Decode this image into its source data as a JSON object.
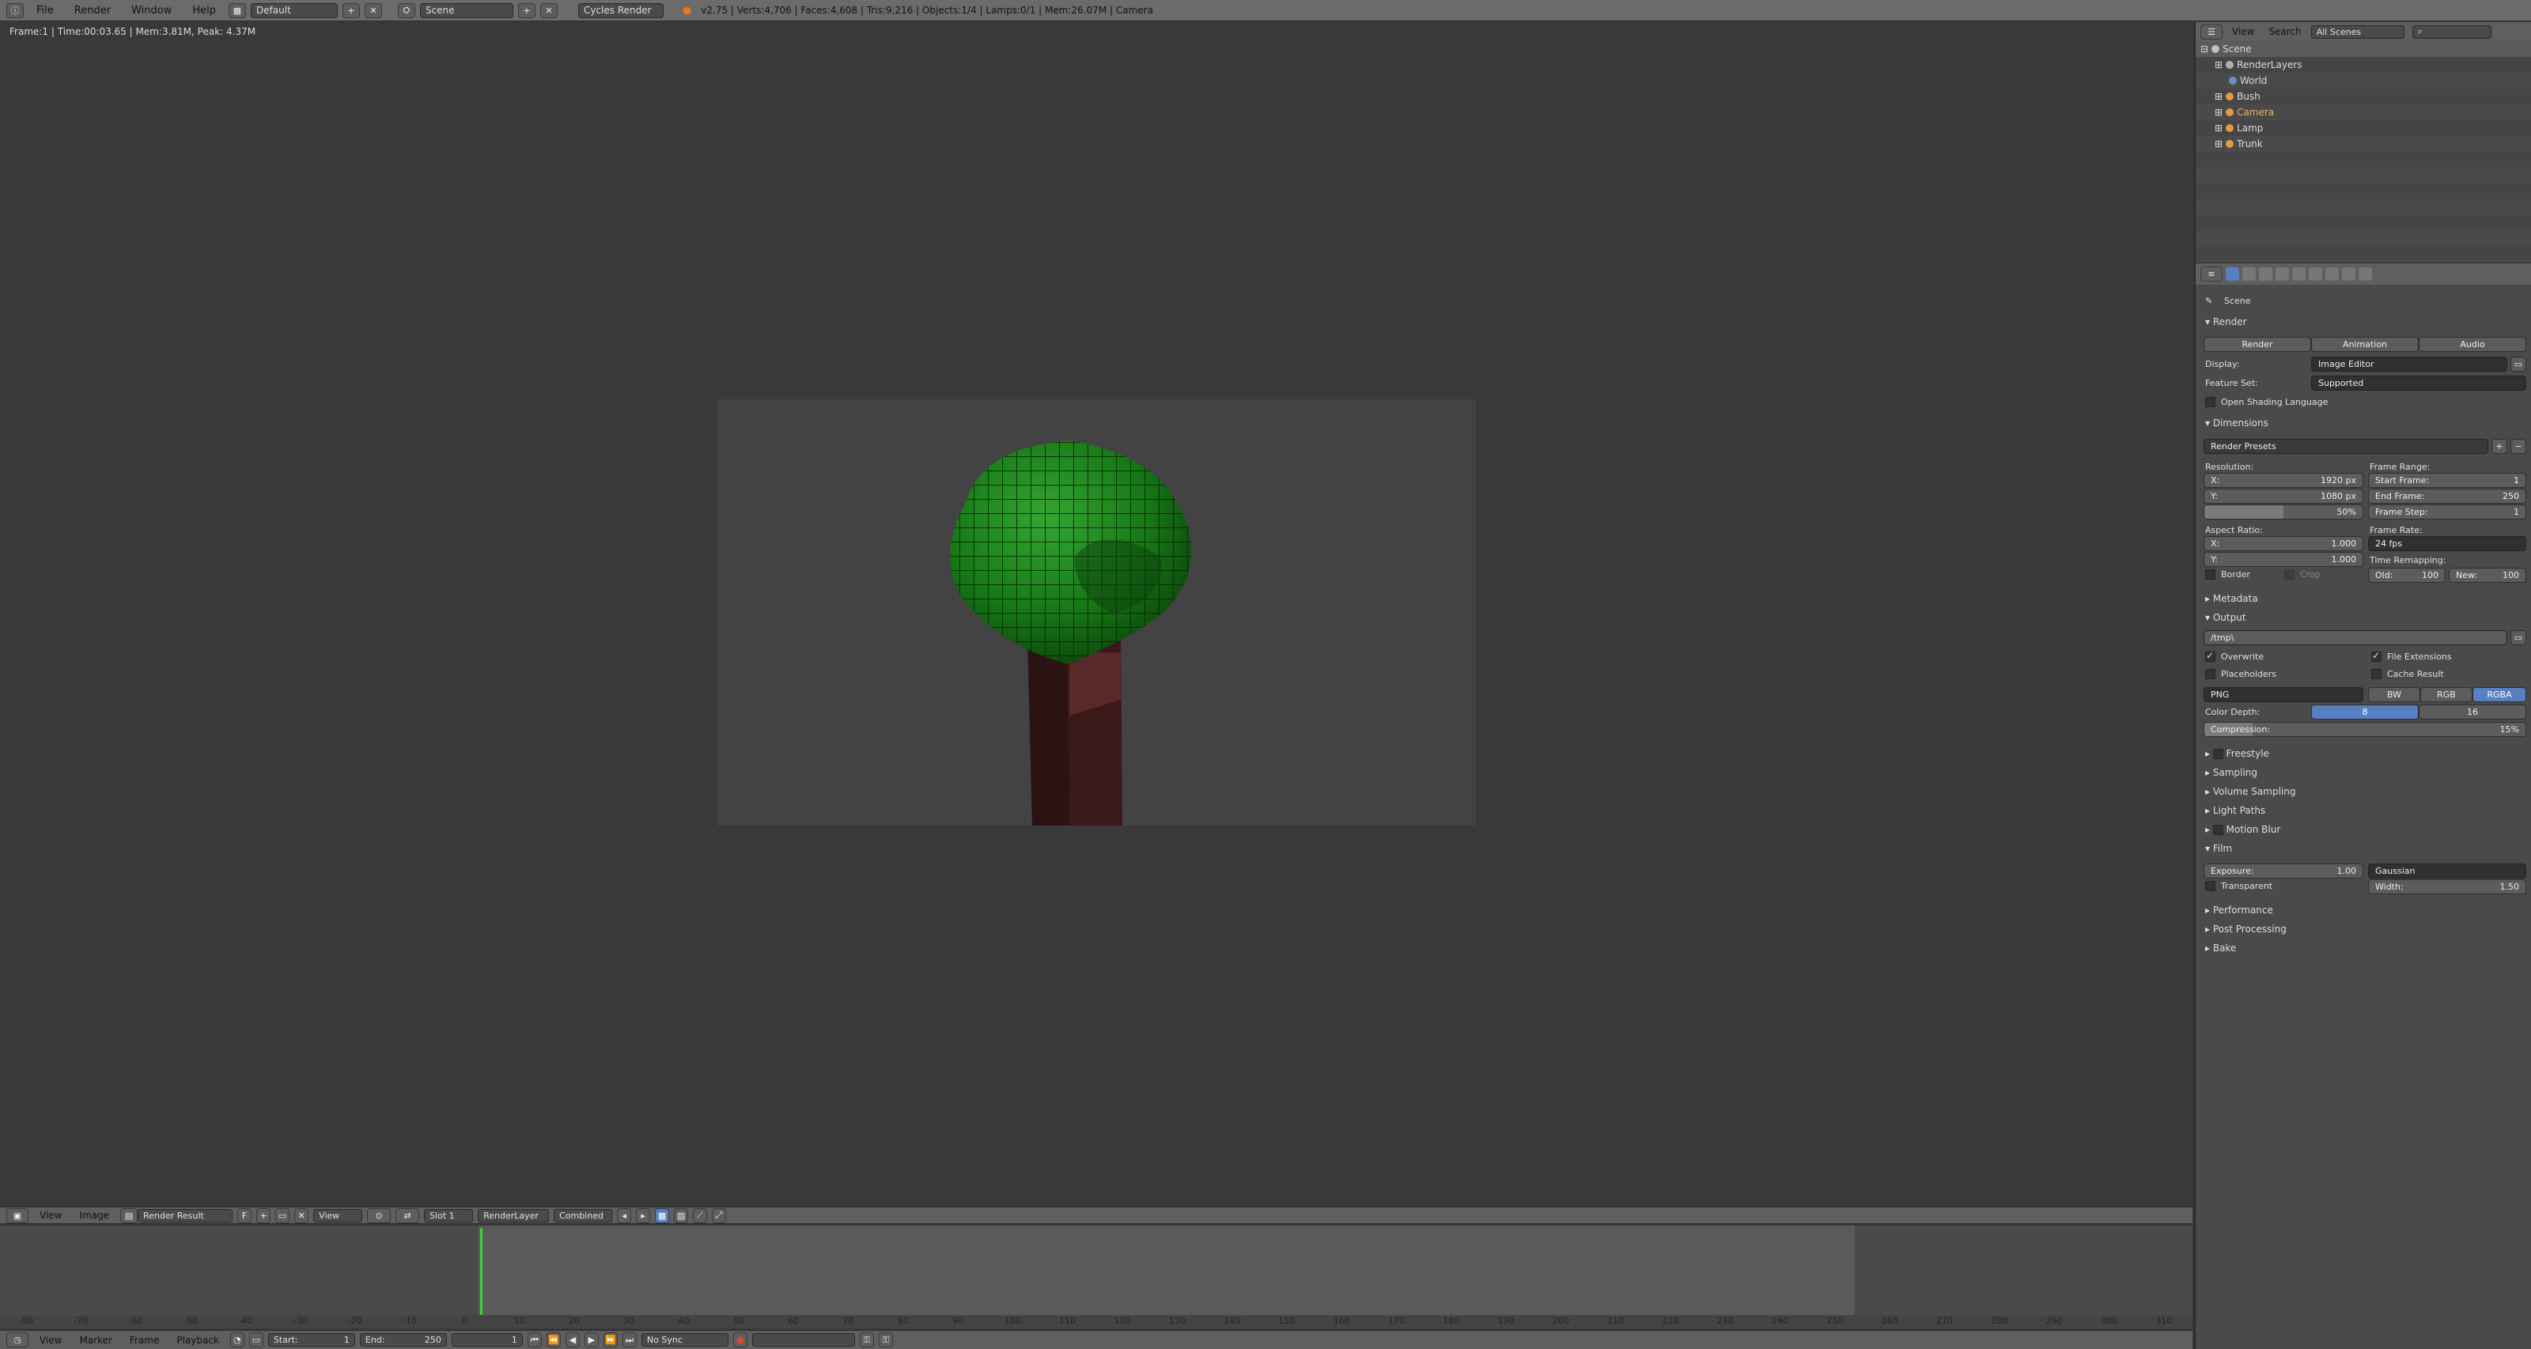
{
  "topbar": {
    "menus": [
      "File",
      "Render",
      "Window",
      "Help"
    ],
    "layout": "Default",
    "scene": "Scene",
    "engine": "Cycles Render",
    "stats": "v2.75 | Verts:4,706 | Faces:4,608 | Tris:9,216 | Objects:1/4 | Lamps:0/1 | Mem:26.07M | Camera"
  },
  "viewport": {
    "render_info": "Frame:1 | Time:00:03.65 | Mem:3.81M, Peak: 4.37M"
  },
  "image_editor": {
    "menus": [
      "View",
      "Image"
    ],
    "image_name": "Render Result",
    "fake_user": "F",
    "view_label": "View",
    "slot": "Slot 1",
    "render_layer": "RenderLayer",
    "pass": "Combined"
  },
  "timeline": {
    "current_frame": 1,
    "ticks": [
      "-80",
      "-70",
      "-60",
      "-50",
      "-40",
      "-30",
      "-20",
      "-10",
      "0",
      "10",
      "20",
      "30",
      "40",
      "50",
      "60",
      "70",
      "80",
      "90",
      "100",
      "110",
      "120",
      "130",
      "140",
      "150",
      "160",
      "170",
      "180",
      "190",
      "200",
      "210",
      "220",
      "230",
      "240",
      "250",
      "260",
      "270",
      "280",
      "290",
      "300",
      "310"
    ],
    "menus": [
      "View",
      "Marker",
      "Frame",
      "Playback"
    ],
    "start_label": "Start:",
    "start_value": "1",
    "end_label": "End:",
    "end_value": "250",
    "frame_value": "1",
    "sync": "No Sync"
  },
  "outliner": {
    "menus": [
      "View",
      "Search"
    ],
    "filter": "All Scenes",
    "items": [
      {
        "label": "Scene",
        "icon": "scene-icon",
        "color": "#c0c0c0"
      },
      {
        "label": "RenderLayers",
        "icon": "renderlayers-icon",
        "color": "#b0b0b0"
      },
      {
        "label": "World",
        "icon": "world-icon",
        "color": "#6a8fc0"
      },
      {
        "label": "Bush",
        "icon": "mesh-object-icon",
        "color": "#e39a3a"
      },
      {
        "label": "Camera",
        "icon": "camera-object-icon",
        "color": "#e39a3a"
      },
      {
        "label": "Lamp",
        "icon": "lamp-object-icon",
        "color": "#e39a3a"
      },
      {
        "label": "Trunk",
        "icon": "mesh-object-icon",
        "color": "#e39a3a"
      }
    ]
  },
  "properties": {
    "context": "Scene",
    "render": {
      "title": "Render",
      "buttons": [
        "Render",
        "Animation",
        "Audio"
      ],
      "display_label": "Display:",
      "display_value": "Image Editor",
      "feature_label": "Feature Set:",
      "feature_value": "Supported",
      "osl_label": "Open Shading Language"
    },
    "dimensions": {
      "title": "Dimensions",
      "presets": "Render Presets",
      "resolution_label": "Resolution:",
      "res_x_label": "X:",
      "res_x": "1920 px",
      "res_y_label": "Y:",
      "res_y": "1080 px",
      "res_pct": "50%",
      "frame_range_label": "Frame Range:",
      "start_label": "Start Frame:",
      "start": "1",
      "end_label": "End Frame:",
      "end": "250",
      "step_label": "Frame Step:",
      "step": "1",
      "aspect_label": "Aspect Ratio:",
      "asp_x_label": "X:",
      "asp_x": "1.000",
      "asp_y_label": "Y:",
      "asp_y": "1.000",
      "frame_rate_label": "Frame Rate:",
      "frame_rate": "24 fps",
      "time_remap_label": "Time Remapping:",
      "old_label": "Old:",
      "old": "100",
      "new_label": "New:",
      "new": "100",
      "border_label": "Border",
      "crop_label": "Crop"
    },
    "metadata_title": "Metadata",
    "output": {
      "title": "Output",
      "path": "/tmp\\",
      "overwrite": "Overwrite",
      "file_ext": "File Extensions",
      "placeholders": "Placeholders",
      "cache": "Cache Result",
      "format": "PNG",
      "color_modes": [
        "BW",
        "RGB",
        "RGBA"
      ],
      "depth_label": "Color Depth:",
      "depths": [
        "8",
        "16"
      ],
      "compression_label": "Compression:",
      "compression": "15%"
    },
    "collapsed": [
      "Freestyle",
      "Sampling",
      "Volume Sampling",
      "Light Paths",
      "Motion Blur"
    ],
    "film": {
      "title": "Film",
      "exposure_label": "Exposure:",
      "exposure": "1.00",
      "filter": "Gaussian",
      "transparent": "Transparent",
      "width_label": "Width:",
      "width": "1.50"
    },
    "collapsed2": [
      "Performance",
      "Post Processing",
      "Bake"
    ]
  }
}
